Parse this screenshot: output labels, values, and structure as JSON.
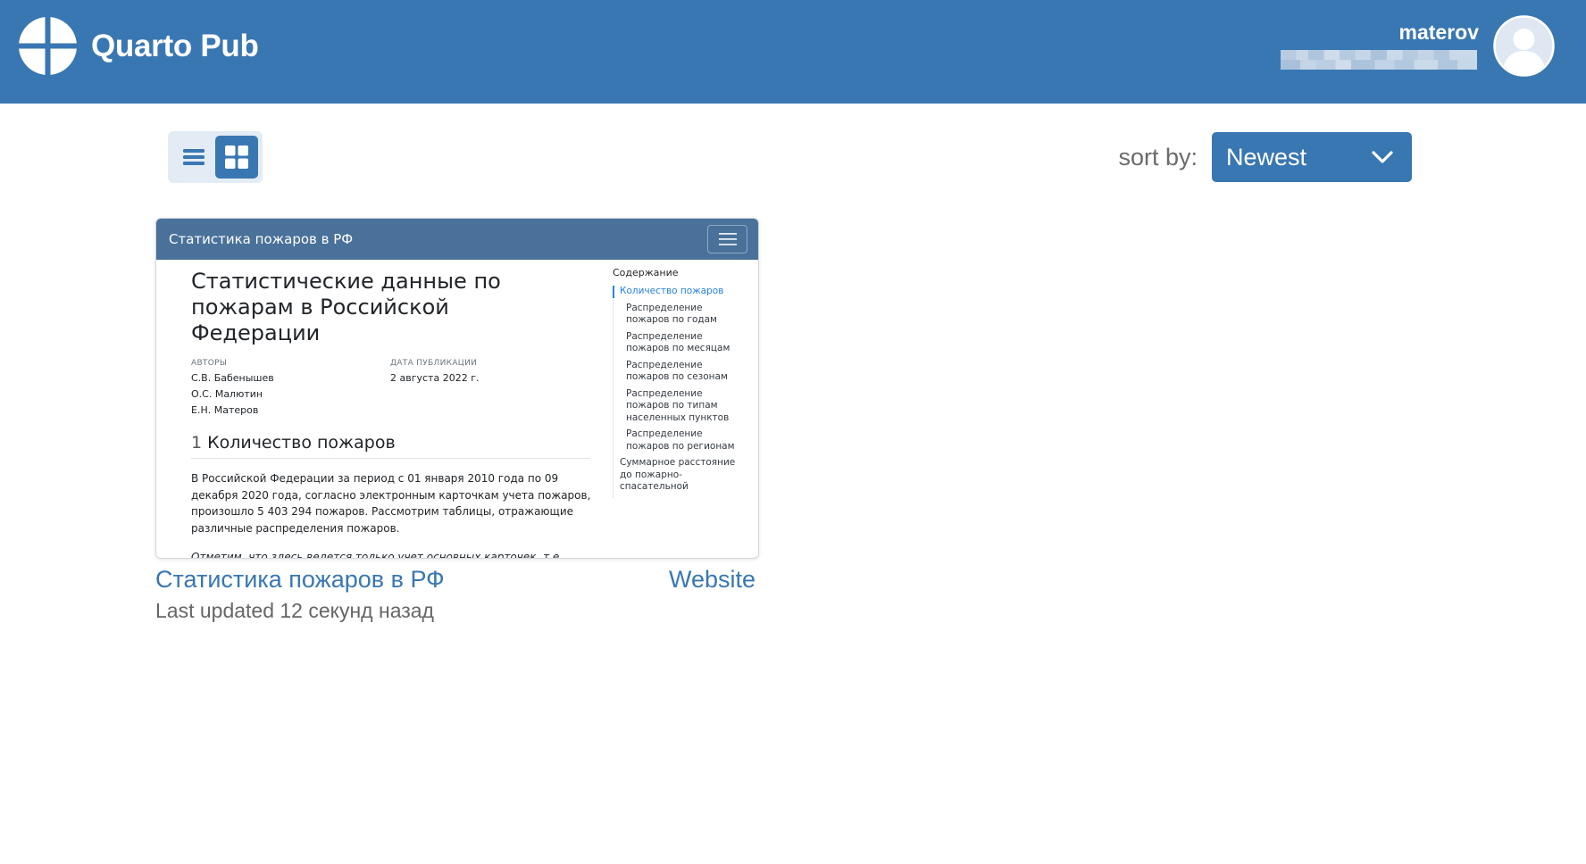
{
  "header": {
    "brand": "Quarto Pub",
    "username": "materov",
    "accent_color": "#3977b2"
  },
  "toolbar": {
    "view_modes": [
      {
        "name": "list",
        "icon": "list-icon",
        "selected": false
      },
      {
        "name": "grid",
        "icon": "grid-icon",
        "selected": true
      }
    ],
    "sort_label": "sort by:",
    "sort_value": "Newest"
  },
  "publications": [
    {
      "title": "Статистика пожаров в РФ",
      "type": "Website",
      "updated": "Last updated 12 секунд назад",
      "thumbnail": {
        "nav_title": "Статистика пожаров в РФ",
        "heading": "Статистические данные по пожарам в Российской Федерации",
        "authors_label": "АВТОРЫ",
        "authors": [
          "С.В. Бабенышев",
          "О.С. Малютин",
          "Е.Н. Матеров"
        ],
        "date_label": "ДАТА ПУБЛИКАЦИИ",
        "date": "2 августа 2022 г.",
        "section_number": "1",
        "section_title": "Количество пожаров",
        "paragraph": "В Российской Федерации за период с 01 января 2010 года по 09 декабря 2020 года, согласно электронным карточкам учета пожаров, произошло 5 403 294 пожаров. Рассмотрим таблицы, отражающие различные распределения пожаров.",
        "paragraph2": "Отметим, что здесь ведется только учет основных карточек, т.е.",
        "toc_title": "Содержание",
        "toc_active": "Количество пожаров",
        "toc_sub": [
          "Распределение пожаров по годам",
          "Распределение пожаров по месяцам",
          "Распределение пожаров по сезонам",
          "Распределение пожаров по типам населенных пунктов",
          "Распределение пожаров по регионам"
        ],
        "toc_next": "Суммарное расстояние до пожарно-спасательной"
      }
    }
  ]
}
